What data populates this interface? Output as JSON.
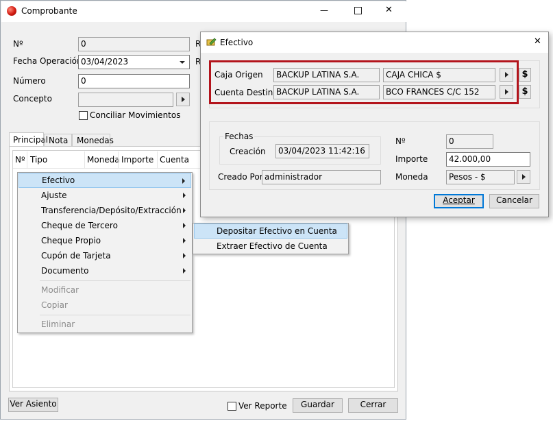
{
  "main_window": {
    "title": "Comprobante",
    "minimize_glyph": "—",
    "maximize_glyph": "☐",
    "close_glyph": "✕",
    "labels": {
      "numero_corto": "Nº",
      "fecha_operacion": "Fecha Operación",
      "numero": "Número",
      "concepto": "Concepto",
      "r1": "R",
      "r2": "R"
    },
    "values": {
      "numero_corto": "0",
      "fecha_operacion": "03/04/2023",
      "numero": "0",
      "concepto": ""
    },
    "conciliar_label": "Conciliar Movimientos",
    "tabs": [
      "Principal",
      "Nota",
      "Monedas"
    ],
    "table_headers": [
      "Nº",
      "Tipo",
      "Moneda",
      "Importe",
      "Cuenta"
    ],
    "buttons": {
      "ver_asiento": "Ver Asiento",
      "ver_reporte": "Ver Reporte",
      "guardar": "Guardar",
      "cerrar": "Cerrar"
    }
  },
  "context_menu": {
    "items": [
      {
        "label": "Efectivo",
        "submenu": true,
        "selected": true
      },
      {
        "label": "Ajuste",
        "submenu": true
      },
      {
        "label": "Transferencia/Depósito/Extracción",
        "submenu": true
      },
      {
        "label": "Cheque de Tercero",
        "submenu": true
      },
      {
        "label": "Cheque Propio",
        "submenu": true
      },
      {
        "label": "Cupón de Tarjeta",
        "submenu": true
      },
      {
        "label": "Documento",
        "submenu": true
      },
      {
        "label": "Modificar",
        "disabled": true
      },
      {
        "label": "Copiar",
        "disabled": true
      },
      {
        "label": "Eliminar",
        "disabled": true
      }
    ],
    "submenu": [
      {
        "label": "Depositar Efectivo en Cuenta",
        "selected": true
      },
      {
        "label": "Extraer Efectivo de Cuenta"
      }
    ]
  },
  "dialog": {
    "title": "Efectivo",
    "close_glyph": "✕",
    "caja_origen_label": "Caja Origen",
    "caja_origen_empresa": "BACKUP LATINA S.A.",
    "caja_origen_cuenta": "CAJA CHICA $",
    "cuenta_destino_label": "Cuenta Destino",
    "cuenta_destino_empresa": "BACKUP LATINA S.A.",
    "cuenta_destino_cuenta": "BCO FRANCES C/C 152",
    "dollar_label": "$",
    "fechas_legend": "Fechas",
    "creacion_label": "Creación",
    "creacion_value": "03/04/2023 11:42:16",
    "creado_por_label": "Creado Por",
    "creado_por_value": "administrador",
    "numero_label": "Nº",
    "numero_value": "0",
    "importe_label": "Importe",
    "importe_value": "42.000,00",
    "moneda_label": "Moneda",
    "moneda_value": "Pesos - $",
    "aceptar_label": "Aceptar",
    "cancelar_label": "Cancelar"
  },
  "colors": {
    "highlight_border": "#b3141c",
    "selection": "#cce4f7"
  }
}
